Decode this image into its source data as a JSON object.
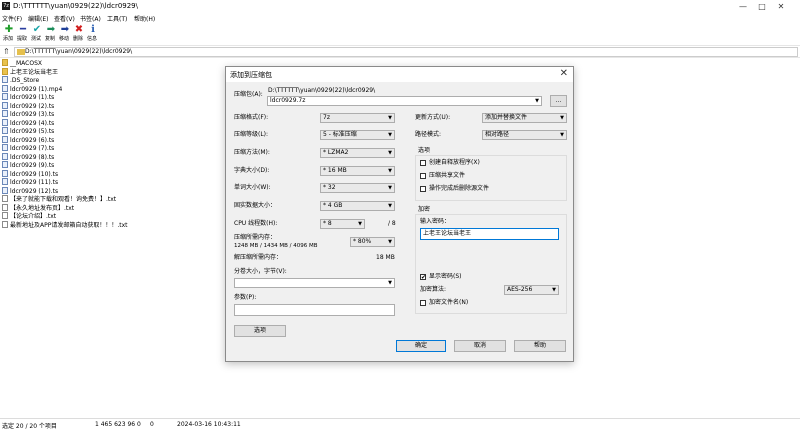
{
  "window": {
    "title": "D:\\TTTTTT\\yuan\\0929(22)\\ldcr0929\\",
    "app_icon": "7z",
    "controls": [
      "—",
      "□",
      "✕"
    ]
  },
  "menu": [
    "文件(F)",
    "编辑(E)",
    "查看(V)",
    "书签(A)",
    "工具(T)",
    "帮助(H)"
  ],
  "toolbar": [
    {
      "label": "添加",
      "icon": "plus-icon",
      "glyph": "✚",
      "color": "#1f9d2a"
    },
    {
      "label": "提取",
      "icon": "minus-icon",
      "glyph": "━",
      "color": "#2c3fa0"
    },
    {
      "label": "测试",
      "icon": "check-icon",
      "glyph": "✔",
      "color": "#1aa5a8"
    },
    {
      "label": "复制",
      "icon": "copy-arrow-icon",
      "glyph": "➡",
      "color": "#1b8d5a"
    },
    {
      "label": "移动",
      "icon": "move-arrow-icon",
      "glyph": "➡",
      "color": "#1e3f99"
    },
    {
      "label": "删除",
      "icon": "delete-icon",
      "glyph": "✖",
      "color": "#d21f1f"
    },
    {
      "label": "信息",
      "icon": "info-icon",
      "glyph": "ℹ",
      "color": "#2a5fb2"
    }
  ],
  "address": "D:\\TTTTTT\\yuan\\0929(22)\\ldcr0929\\",
  "files": [
    {
      "name": "__MACOSX",
      "type": "folder"
    },
    {
      "name": "上老王论坛当老王",
      "type": "folder"
    },
    {
      "name": ".DS_Store",
      "type": "file"
    },
    {
      "name": "ldcr0929 (1).mp4",
      "type": "file"
    },
    {
      "name": "ldcr0929 (1).ts",
      "type": "file"
    },
    {
      "name": "ldcr0929 (2).ts",
      "type": "file"
    },
    {
      "name": "ldcr0929 (3).ts",
      "type": "file"
    },
    {
      "name": "ldcr0929 (4).ts",
      "type": "file"
    },
    {
      "name": "ldcr0929 (5).ts",
      "type": "file"
    },
    {
      "name": "ldcr0929 (6).ts",
      "type": "file"
    },
    {
      "name": "ldcr0929 (7).ts",
      "type": "file"
    },
    {
      "name": "ldcr0929 (8).ts",
      "type": "file"
    },
    {
      "name": "ldcr0929 (9).ts",
      "type": "file"
    },
    {
      "name": "ldcr0929 (10).ts",
      "type": "file"
    },
    {
      "name": "ldcr0929 (11).ts",
      "type": "file"
    },
    {
      "name": "ldcr0929 (12).ts",
      "type": "file"
    },
    {
      "name": "【来了就能下载和观看！询免费！】.txt",
      "type": "txt"
    },
    {
      "name": "【永久地址发布页】.txt",
      "type": "txt"
    },
    {
      "name": "【论坛介绍】.txt",
      "type": "txt"
    },
    {
      "name": "最新地址及APP请发邮箱自动获取！！！.txt",
      "type": "txt"
    }
  ],
  "status": {
    "selected": "选定 20 / 20 个项目",
    "size": "1 465 623 96 0",
    "size2": "0",
    "date": "2024-03-16 10:43:11"
  },
  "dialog": {
    "title": "添加到压缩包",
    "archive_label": "压缩包(A):",
    "archive_path": "D:\\TTTTTT\\yuan\\0929(22)\\ldcr0929\\",
    "archive_name": "ldcr0929.7z",
    "browse": "...",
    "format_label": "压缩格式(F):",
    "format_value": "7z",
    "level_label": "压缩等级(L):",
    "level_value": "5 - 标准压缩",
    "method_label": "压缩方法(M):",
    "method_value": "* LZMA2",
    "dict_label": "字典大小(D):",
    "dict_value": "* 16 MB",
    "word_label": "单词大小(W):",
    "word_value": "* 32",
    "solid_label": "固实数据大小：",
    "solid_value": "* 4 GB",
    "threads_label": "CPU 线程数(H):",
    "threads_value": "* 8",
    "threads_total": "/ 8",
    "mem_label": "压缩所需内存：",
    "mem_value": "1248 MB / 1434 MB / 4096 MB",
    "mem_pct": "* 80%",
    "decomp_label": "解压缩所需内存：",
    "decomp_value": "18 MB",
    "split_label": "分卷大小，字节(V):",
    "split_value": "",
    "params_label": "参数(P):",
    "params_value": "",
    "options_button": "选项",
    "update_label": "更新方式(U):",
    "update_value": "添加并替换文件",
    "path_label": "路径模式:",
    "path_value": "相对路径",
    "options_group": "选项",
    "opt_sfx": "创建自释放程序(X)",
    "opt_shared": "压缩共享文件",
    "opt_delete": "操作完成后删除源文件",
    "enc_group": "加密",
    "pwd_label": "输入密码：",
    "pwd_value": "上老王论坛当老王",
    "show_pwd": "显示密码(S)",
    "check_mark": "✔",
    "enc_method_label": "加密算法:",
    "enc_method_value": "AES-256",
    "enc_names": "加密文件名(N)",
    "ok": "确定",
    "cancel": "取消",
    "help": "帮助"
  }
}
